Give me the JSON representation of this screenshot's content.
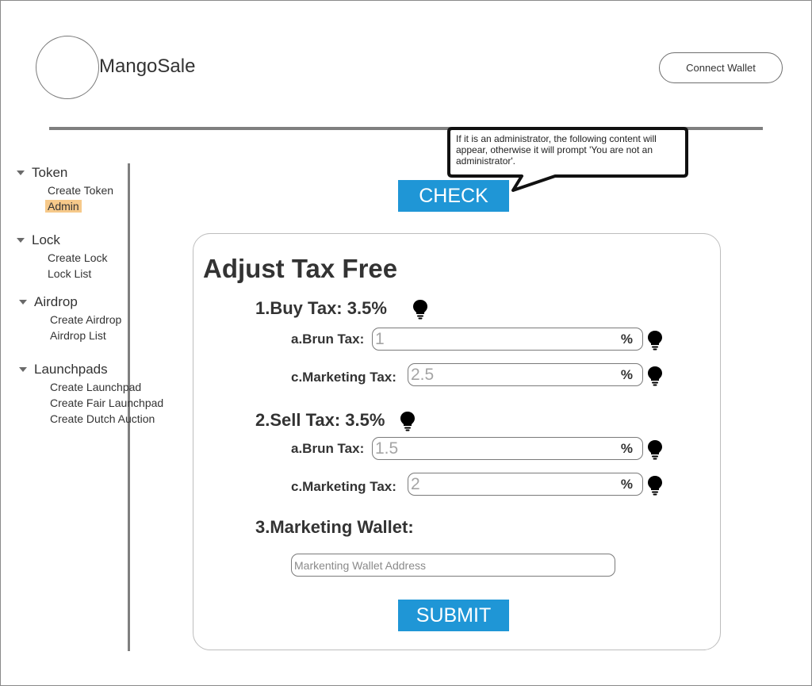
{
  "header": {
    "app_title": "MangoSale",
    "connect_wallet_label": "Connect Wallet"
  },
  "sidebar": {
    "groups": [
      {
        "label": "Token",
        "items": [
          "Create Token",
          "Admin"
        ]
      },
      {
        "label": "Lock",
        "items": [
          "Create Lock",
          "Lock List"
        ]
      },
      {
        "label": "Airdrop",
        "items": [
          "Create Airdrop",
          "Airdrop List"
        ]
      },
      {
        "label": "Launchpads",
        "items": [
          "Create Launchpad",
          "Create Fair Launchpad",
          "Create Dutch Auction"
        ]
      }
    ],
    "active_item": "Admin",
    "highlight_color": "#f6c98a"
  },
  "callout": {
    "text": "If it is an administrator, the following content will appear, otherwise it will prompt 'You are not an administrator'."
  },
  "check_label": "CHECK",
  "form": {
    "title": "Adjust Tax Free",
    "buy": {
      "title": "1.Buy Tax: 3.5%",
      "brun_label": "a.Brun Tax:",
      "brun_placeholder": "1",
      "marketing_label": "c.Marketing Tax:",
      "marketing_placeholder": "2.5"
    },
    "sell": {
      "title": "2.Sell Tax: 3.5%",
      "brun_label": "a.Brun Tax:",
      "brun_placeholder": "1.5",
      "marketing_label": "c.Marketing Tax:",
      "marketing_placeholder": "2"
    },
    "percent_symbol": "%",
    "wallet_title": "3.Marketing Wallet:",
    "wallet_placeholder": "Markenting Wallet Address",
    "submit_label": "SUBMIT"
  },
  "icons": {
    "tip": "lightbulb-icon",
    "sidebar_expand": "caret-down-icon"
  },
  "colors": {
    "button_blue": "#1f96d6",
    "divider_gray": "#7f7f7f"
  }
}
